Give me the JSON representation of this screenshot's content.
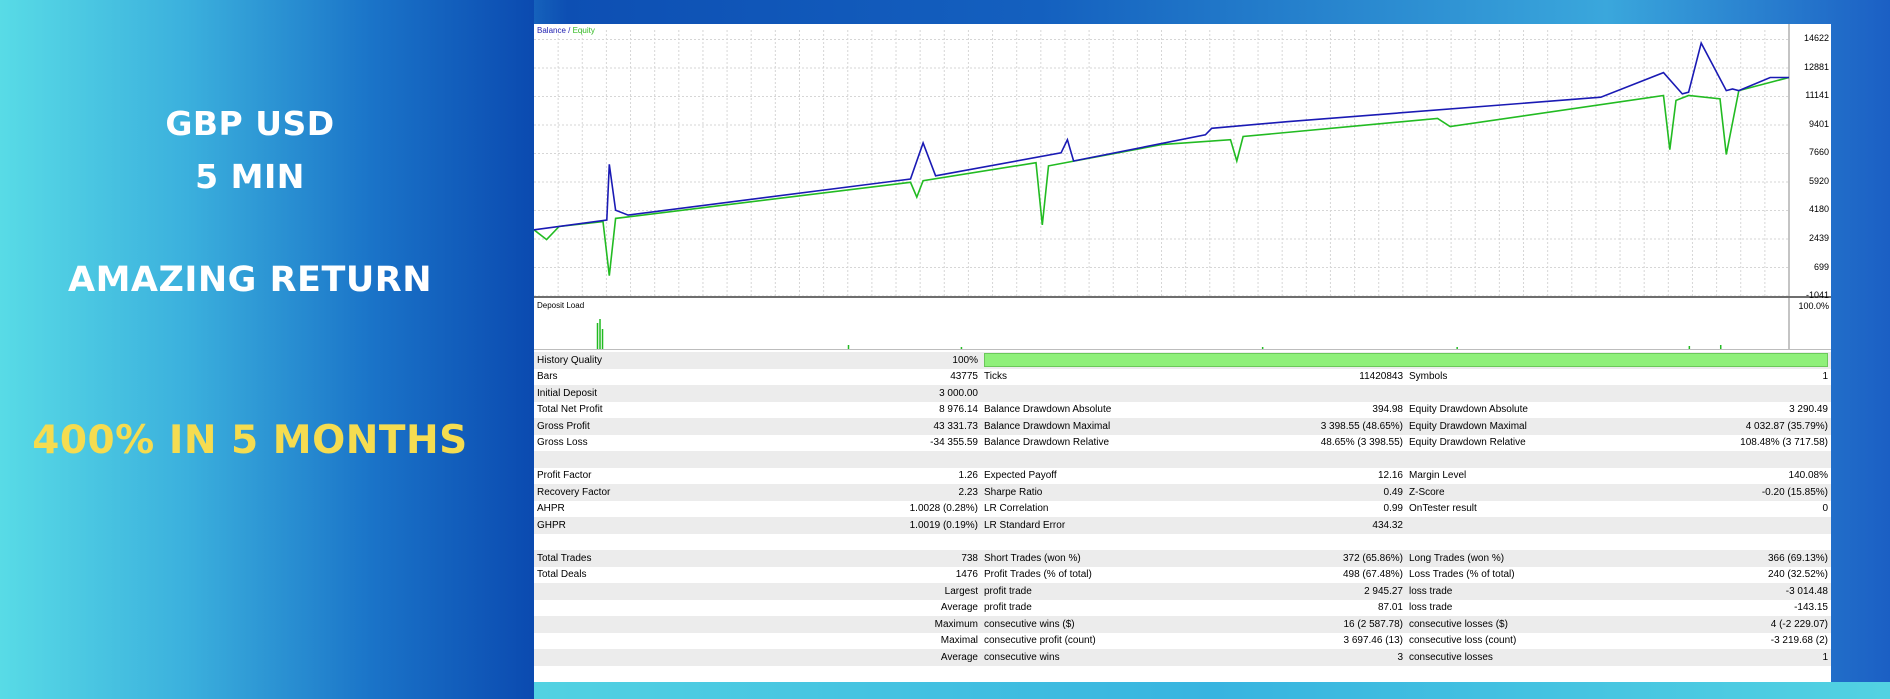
{
  "banner": {
    "line1": "GBP USD",
    "line2": "5 MIN",
    "line3": "AMAZING RETURN",
    "line4": "400% IN 5 MONTHS"
  },
  "chart_legend": {
    "balance": "Balance",
    "sep": " / ",
    "equity": "Equity"
  },
  "deposit_load": {
    "title": "Deposit Load",
    "max_label": "100.0%"
  },
  "colors": {
    "balance": "#1a1ab4",
    "equity": "#22bb22",
    "quality_bar": "#8ff07a",
    "highlight": "#f5dc50"
  },
  "chart_data": {
    "type": "line",
    "yticks": [
      "14622",
      "12881",
      "11141",
      "9401",
      "7660",
      "5920",
      "4180",
      "2439",
      "699",
      "-1041"
    ],
    "ylim": [
      -1041,
      15200
    ],
    "grid": true,
    "series": [
      {
        "name": "Balance",
        "x": [
          0,
          0.058,
          0.06,
          0.065,
          0.075,
          0.3,
          0.31,
          0.32,
          0.42,
          0.425,
          0.43,
          0.535,
          0.54,
          0.6,
          0.85,
          0.9,
          0.915,
          0.92,
          0.93,
          0.95,
          0.955,
          0.96,
          0.985,
          1.0
        ],
        "y": [
          3000,
          3600,
          7000,
          4200,
          3900,
          6100,
          8300,
          6300,
          7700,
          8500,
          7200,
          8800,
          9200,
          9600,
          11100,
          12600,
          11300,
          11400,
          14400,
          11500,
          11600,
          11500,
          12300,
          12300
        ]
      },
      {
        "name": "Equity",
        "x": [
          0,
          0.01,
          0.02,
          0.055,
          0.06,
          0.065,
          0.3,
          0.305,
          0.31,
          0.4,
          0.405,
          0.41,
          0.5,
          0.555,
          0.56,
          0.565,
          0.72,
          0.73,
          0.9,
          0.905,
          0.91,
          0.92,
          0.945,
          0.95,
          0.96,
          1.0
        ],
        "y": [
          3000,
          2400,
          3200,
          3500,
          200,
          3700,
          5900,
          5000,
          6000,
          7100,
          3300,
          6900,
          8200,
          8500,
          7200,
          8700,
          9800,
          9300,
          11200,
          7900,
          10900,
          11200,
          11000,
          7600,
          11500,
          12300
        ]
      }
    ]
  },
  "stats": {
    "rows": [
      {
        "shade": true,
        "cells": [
          "History Quality",
          "100%",
          "",
          "",
          "",
          ""
        ],
        "bar": true
      },
      {
        "shade": false,
        "cells": [
          "Bars",
          "43775",
          "Ticks",
          "11420843",
          "Symbols",
          "1"
        ]
      },
      {
        "shade": true,
        "cells": [
          "Initial Deposit",
          "3 000.00",
          "",
          "",
          "",
          ""
        ]
      },
      {
        "shade": false,
        "cells": [
          "Total Net Profit",
          "8 976.14",
          "Balance Drawdown Absolute",
          "394.98",
          "Equity Drawdown Absolute",
          "3 290.49"
        ]
      },
      {
        "shade": true,
        "cells": [
          "Gross Profit",
          "43 331.73",
          "Balance Drawdown Maximal",
          "3 398.55 (48.65%)",
          "Equity Drawdown Maximal",
          "4 032.87 (35.79%)"
        ]
      },
      {
        "shade": false,
        "cells": [
          "Gross Loss",
          "-34 355.59",
          "Balance Drawdown Relative",
          "48.65% (3 398.55)",
          "Equity Drawdown Relative",
          "108.48% (3 717.58)"
        ]
      },
      {
        "shade": true,
        "cells": [
          "",
          "",
          "",
          "",
          "",
          ""
        ]
      },
      {
        "shade": false,
        "cells": [
          "Profit Factor",
          "1.26",
          "Expected Payoff",
          "12.16",
          "Margin Level",
          "140.08%"
        ]
      },
      {
        "shade": true,
        "cells": [
          "Recovery Factor",
          "2.23",
          "Sharpe Ratio",
          "0.49",
          "Z-Score",
          "-0.20 (15.85%)"
        ]
      },
      {
        "shade": false,
        "cells": [
          "AHPR",
          "1.0028 (0.28%)",
          "LR Correlation",
          "0.99",
          "OnTester result",
          "0"
        ]
      },
      {
        "shade": true,
        "cells": [
          "GHPR",
          "1.0019 (0.19%)",
          "LR Standard Error",
          "434.32",
          "",
          ""
        ]
      },
      {
        "shade": false,
        "cells": [
          "",
          "",
          "",
          "",
          "",
          ""
        ]
      },
      {
        "shade": true,
        "cells": [
          "Total Trades",
          "738",
          "Short Trades (won %)",
          "372 (65.86%)",
          "Long Trades (won %)",
          "366 (69.13%)"
        ]
      },
      {
        "shade": false,
        "cells": [
          "Total Deals",
          "1476",
          "Profit Trades (% of total)",
          "498 (67.48%)",
          "Loss Trades (% of total)",
          "240 (32.52%)"
        ]
      },
      {
        "shade": true,
        "cells": [
          "",
          "Largest",
          "profit trade",
          "2 945.27",
          "loss trade",
          "-3 014.48"
        ]
      },
      {
        "shade": false,
        "cells": [
          "",
          "Average",
          "profit trade",
          "87.01",
          "loss trade",
          "-143.15"
        ]
      },
      {
        "shade": true,
        "cells": [
          "",
          "Maximum",
          "consecutive wins ($)",
          "16 (2 587.78)",
          "consecutive losses ($)",
          "4 (-2 229.07)"
        ]
      },
      {
        "shade": false,
        "cells": [
          "",
          "Maximal",
          "consecutive profit (count)",
          "3 697.46 (13)",
          "consecutive loss (count)",
          "-3 219.68 (2)"
        ]
      },
      {
        "shade": true,
        "cells": [
          "",
          "Average",
          "consecutive wins",
          "3",
          "consecutive losses",
          "1"
        ]
      }
    ]
  }
}
